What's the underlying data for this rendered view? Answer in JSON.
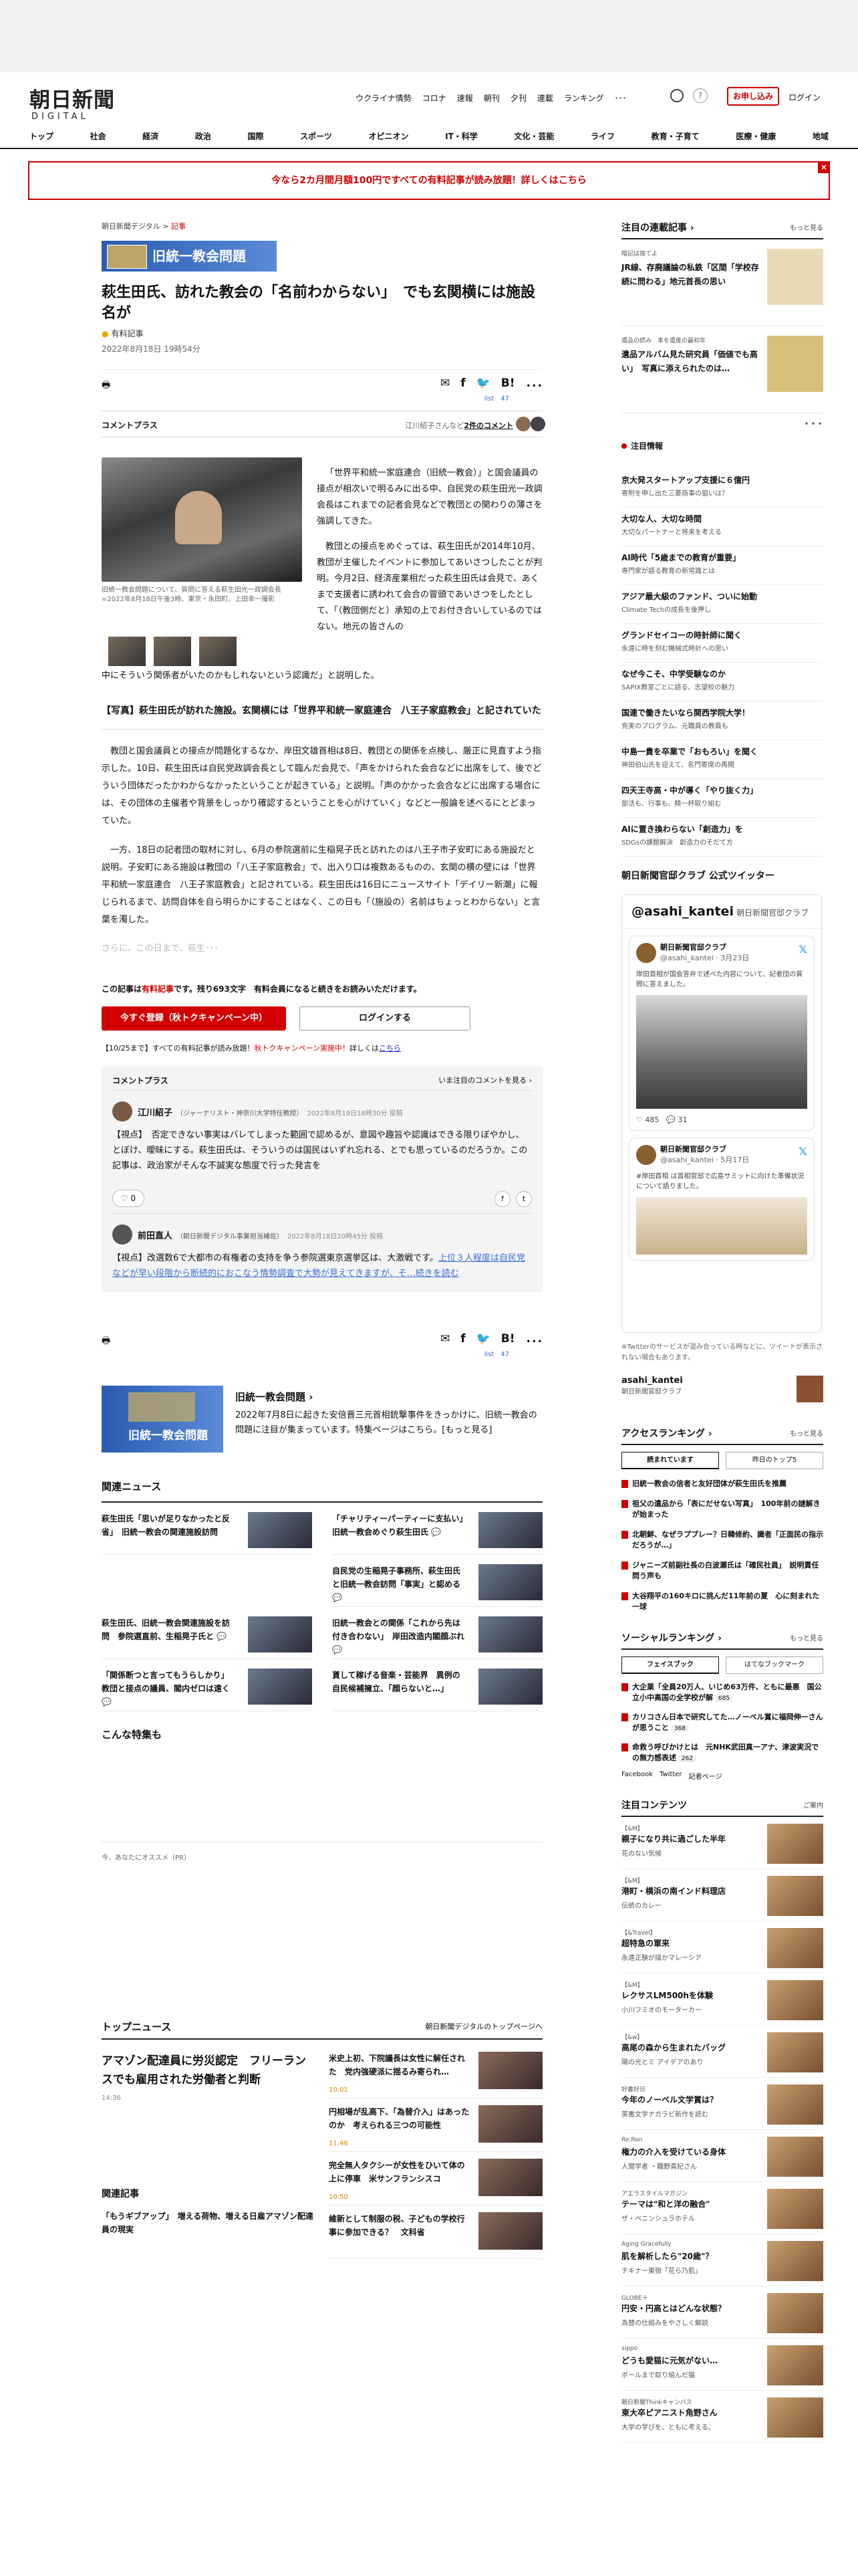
{
  "header": {
    "logo_jp": "朝日新聞",
    "logo_en": "DIGITAL",
    "nav": [
      "ウクライナ情勢",
      "コロナ",
      "速報",
      "朝刊",
      "夕刊",
      "連載",
      "ランキング",
      "･･･"
    ],
    "help": "?",
    "subscribe": "お申し込み",
    "login": "ログイン",
    "main_nav": [
      "トップ",
      "社会",
      "経済",
      "政治",
      "国際",
      "スポーツ",
      "オピニオン",
      "IT・科学",
      "文化・芸能",
      "ライフ",
      "教育・子育て",
      "医療・健康",
      "地域"
    ]
  },
  "banner": {
    "text": "今なら2カ月間月額100円ですべての有料記事が読み放題！詳しくはこちら",
    "close": "×"
  },
  "article": {
    "breadcrumb_site": "朝日新聞デジタル",
    "breadcrumb_sep": ">",
    "breadcrumb_section": "記事",
    "tag_banner": "旧統一教会問題",
    "title": "萩生田氏、訪れた教会の「名前わからない」　でも玄関横には施設名が",
    "paid_label": "有料記事",
    "date": "2022年8月18日 19時54分",
    "print": "🖶",
    "share": [
      "✉",
      "f",
      "🐦",
      "B!",
      "･･･"
    ],
    "share_counts": "list　47",
    "comment_plus": "コメントプラス",
    "comment_summary_pre": "江川紹子さんなど",
    "comment_summary_link": "2件のコメント",
    "photo_caption": "旧統一教会問題について、質問に答える萩生田光一政調会長=2022年8月18日午後3時、東京・永田町、上田幸一撮影",
    "lede": "「世界平和統一家庭連合（旧統一教会）」と国会議員の接点が相次いで明るみに出る中、自民党の萩生田光一政調会長はこれまでの記者会見などで教団との関わりの薄さを強調してきた。",
    "p1a": "教団との接点をめぐっては、萩生田氏が2014年10月、教団が主催したイベントに参加してあいさつしたことが判明。今月2日、経済産業相だった萩生田氏は会見で、あくまで支援者に誘われて会合の冒頭であいさつをしたとして、「（教団側だと）承知の上でお付き合いしているのではない。地元の皆さんの",
    "p1b": "中にそういう関係者がいたのかもしれないという認識だ」と説明した。",
    "related": "【写真】萩生田氏が訪れた施設。玄関横には「世界平和統一家庭連合　八王子家庭教会」と記されていた",
    "p2": "教団と国会議員との接点が問題化するなか、岸田文雄首相は8日、教団との関係を点検し、厳正に見直すよう指示した。10日、萩生田氏は自民党政調会長として臨んだ会見で、「声をかけられた会合などに出席をして、後でどういう団体だったかわからなかったということが起きている」と説明。「声のかかった会合などに出席する場合には、その団体の主催者や背景をしっかり確認するということを心がけていく」などと一般論を述べるにとどまっていた。",
    "p3": "一方、18日の記者団の取材に対し、6月の参院選前に生稲晃子氏と訪れたのは八王子市子安町にある施設だと説明。子安町にある施設は教団の「八王子家庭教会」で、出入り口は複数あるものの、玄関の横の壁には「世界平和統一家庭連合　八王子家庭教会」と記されている。萩生田氏は16日にニュースサイト「デイリー新潮」に報じられるまで、訪問自体を自ら明らかにすることはなく、この日も「（施設の）名前はちょっとわからない」と言葉を濁した。",
    "fade": "さらに、この日まで、萩生･･･"
  },
  "paywall": {
    "pre": "この記事は",
    "paid": "有料記事",
    "post": "です。残り693文字　有料会員になると続きをお読みいただけます。",
    "register": "今すぐ登録（秋トクキャンペーン中）",
    "login": "ログインする",
    "note_pre": "【10/25まで】すべての有料記事が読み放題！",
    "note_red": "秋トクキャンペーン実施中！",
    "note_post": "詳しくは",
    "note_link": "こちら"
  },
  "comments": {
    "title": "コメントプラス",
    "viewing": "いま注目のコメントを見る ›",
    "items": [
      {
        "name": "江川紹子",
        "role": "（ジャーナリスト・神奈川大学特任教授）",
        "time": "2022年8月19日18時30分 投稿",
        "text": "【視点】　否定できない事実はバレてしまった範囲で認めるが、意図や趣旨や認識はできる限りぼやかし、とぼけ、曖昧にする。萩生田氏は、そういうのは国民はいずれ忘れる、とでも思っているのだろうか。この記事は、政治家がそんな不誠実な態度で行った発言を",
        "likes": "0"
      },
      {
        "name": "前田直人",
        "role": "（朝日新聞デジタル事業担当補佐）",
        "time": "2022年8月18日20時45分 投稿",
        "text": "【視点】改選数6で大都市の有権者の支持を争う参院選東京選挙区は、大激戦です。",
        "text_link": "上位３人程度は自民党などが早い段階から断続的におこなう情勢調査で大勢が見えてきますが、そ",
        "more": "…続きを読む"
      }
    ]
  },
  "special": {
    "img_label": "旧統一教会問題",
    "title": "旧統一教会問題 ›",
    "desc": "2022年7月8日に起きた安倍晋三元首相銃撃事件をきっかけに、旧統一教会の問題に注目が集まっています。特集ページはこちら。[もっと見る]"
  },
  "related_news": {
    "title": "関連ニュース",
    "items": [
      "萩生田氏「思いが足りなかったと反省」　旧統一教会の関連施設訪問",
      "「チャリティーパーティーに支払い」　旧統一教会めぐり萩生田氏 💬",
      "",
      "自民党の生稲晃子事務所、萩生田氏と旧統一教会訪問「事実」と認める 💬",
      "萩生田氏、旧統一教会関連施設を訪問　参院選直前、生稲晃子氏と 💬",
      "旧統一教会との関係「これから先は付き合わない」　岸田改造内閣顔ぶれ 💬",
      "「関係断つと言ってもうらしかり」　教団と接点の議員、閣内ゼロは遠く 💬",
      "貰して稼げる音楽・芸能界　異例の自民候補擁立、「顔らないと…」"
    ]
  },
  "tokusyu": "こんな特集も",
  "osusume": "今、あなたにオススメ（PR）",
  "top_news": {
    "title": "トップニュース",
    "link": "朝日新聞デジタルのトップページへ",
    "lead": "アマゾン配達員に労災認定　フリーランスでも雇用された労働者と判断",
    "lead_time": "14:36",
    "items": [
      {
        "t": "米史上初、下院議長は女性に解任された　党内強硬派に揺るみ寄られ…",
        "tm": "10:01"
      },
      {
        "t": "円相場が乱高下、「為替介入」はあったのか　考えられる三つの可能性",
        "tm": "11:46"
      },
      {
        "t": "完全無人タクシーが女性をひいて体の上に停車　米サンフランシスコ",
        "tm": "10:50"
      },
      {
        "t": "維新として制服の税、子どもの学校行事に参加できる？　文科省",
        "tm": ""
      }
    ],
    "kanren_title": "関連記事",
    "kanren_item": "「もうギブアップ」　増える荷物、増える日雇アマゾン配達員の現実"
  },
  "sidebar": {
    "serial_title": "注目の連載記事 ›",
    "serial_more": "もっと見る",
    "serials": [
      {
        "s": "暗記は捨てよ",
        "t": "JR線、存廃議論の私鉄「区間「学校存続に問わる」地元首長の思い"
      },
      {
        "s": "遺品の読み　本を遺産の最初年",
        "t": "遺品アルバム見た研究員「価値でも高い」　写真に添えられたのは…"
      }
    ],
    "dots": "･･･",
    "topic_title": "注目情報",
    "topics": [
      {
        "t": "京大発スタートアップ支援に６億円",
        "s": "寄附を申し出た三菱商事の狙いは？"
      },
      {
        "t": "大切な人、大切な時間",
        "s": "大切なパートナーと将来を考える"
      },
      {
        "t": "AI時代「5歳までの教育が重要」",
        "s": "専門家が語る教育の新常識とは"
      },
      {
        "t": "アジア最大級のファンド、ついに始動",
        "s": "Climate Techの成長を後押し"
      },
      {
        "t": "グランドセイコーの時計師に聞く",
        "s": "永遠に時を刻む機械式時計への思い"
      },
      {
        "t": "なぜ今こそ、中学受験なのか",
        "s": "SAPIX教室ごとに語る、志望校の魅力"
      },
      {
        "t": "国連で働きたいなら関西学院大学！",
        "s": "充実のプログラム、元職員の教員も"
      },
      {
        "t": "中島一貴を卒業で「おもろい」を聞く",
        "s": "神田伯山氏を迎えて、名門寄席の再開"
      },
      {
        "t": "四天王寺高・中が導く「やり抜く力」",
        "s": "部活も、行事も、精一杯取り組む"
      },
      {
        "t": "AIに置き換わらない「創造力」を",
        "s": "SDGsの課題解決　創造力のそだて方"
      }
    ],
    "twitter_title": "朝日新聞官邸クラブ 公式ツイッター",
    "tw_handle": "@asahi_kantei",
    "tw_name": "朝日新聞官邸クラブ",
    "tw_card1_name": "朝日新聞官邸クラブ",
    "tw_card1_meta": "@asahi_kantei · 3月23日",
    "tw_card1_text": "岸田首相が国会答弁で述べた内容について、記者団の質問に答えました。",
    "tw_card1_stats": "♡ 485　💬 31",
    "tw_card2_name": "朝日新聞官邸クラブ",
    "tw_card2_meta": "@asahi_kantei · 5月17日",
    "tw_card2_text": "#岸田首相 は首相官邸で広島サミットに向けた準備状況について語りました。",
    "tw_note": "※Twitterのサービスが混み合っている時などに、ツイートが表示されない場合もあります。",
    "acct_name": "asahi_kantei",
    "acct_sub": "朝日新聞官邸クラブ",
    "rank_title": "アクセスランキング ›",
    "rank_more": "もっと見る",
    "rank_tabs": [
      "読まれています",
      "昨日のトップ5"
    ],
    "ranks": [
      "旧統一教会の信者と友好団体が萩生田氏を推薦",
      "祖父の遺品から「表にだせない写真」　100年前の謎解きが始まった",
      "北朝鮮、なぜラププレー？日韓修約、識者「正面民の指示だろうが…」",
      "ジャニーズ前副社長の白波瀬氏は「確民社員」　説明責任問う声も",
      "大谷翔平の160キロに挑んだ11年前の夏　心に刻まれた一球"
    ],
    "social_title": "ソーシャルランキング ›",
    "social_more": "もっと見る",
    "social_tabs": [
      "フェイスブック",
      "はてなブックマーク"
    ],
    "socials": [
      {
        "t": "大企業「全員20万人、いじめ63万件、ともに最悪　国公立小中高国の全学校が解",
        "c": "685"
      },
      {
        "t": "カリコさん日本で研究してた…ノーベル賞に福岡伸一さんが思うこと",
        "c": "368"
      },
      {
        "t": "命救う呼びかけとは　元NHK武田真一アナ、津波実況での無力感表述",
        "c": "262"
      }
    ],
    "social_foot": [
      "Facebook",
      "Twitter",
      "記者ページ"
    ],
    "content_title": "注目コンテンツ",
    "content_more": "ご案内",
    "contents": [
      {
        "s": "【&M】",
        "t": "親子になり共に過ごした半年",
        "d": "花のない気候"
      },
      {
        "s": "【&M】",
        "t": "港町・横浜の南インド料理店",
        "d": "伝統のカレー"
      },
      {
        "s": "【&Travel】",
        "t": "超特急の軍来",
        "d": "永遠正験が描かマレーシア"
      },
      {
        "s": "【&M】",
        "t": "レクサスLM500hを体験",
        "d": "小川フミオのモーターカー"
      },
      {
        "s": "【&w】",
        "t": "高尾の森から生まれたバッグ",
        "d": "陽の光とミ アイデアのあり"
      },
      {
        "s": "好書好日",
        "t": "今年のノーベル文学賞は？",
        "d": "英書文学ナガラビ新作を読む"
      },
      {
        "s": "Re:Ron",
        "t": "権力の介入を受けている身体",
        "d": "人間学者 ・職野真紀さん"
      },
      {
        "s": "アエラスタイルマガジン",
        "t": "テーマは\"和と洋の融合\"",
        "d": "ザ・ペニンシュラホテル"
      },
      {
        "s": "Aging Gracefully",
        "t": "肌を解析したら\"20歳\"？",
        "d": "チキナー東宿「花ら乃肌」"
      },
      {
        "s": "GLOBE＋",
        "t": "円安・円高とはどんな状態？",
        "d": "為替の仕組みをやさしく解説"
      },
      {
        "s": "sippo",
        "t": "どうも愛猫に元気がない…",
        "d": "ボールまで取り組んだ猫"
      },
      {
        "s": "朝日新聞Thinkキャンパス",
        "t": "東大卒ピアニスト角野さん",
        "d": "大学の学びを、ともに考える。"
      }
    ]
  }
}
